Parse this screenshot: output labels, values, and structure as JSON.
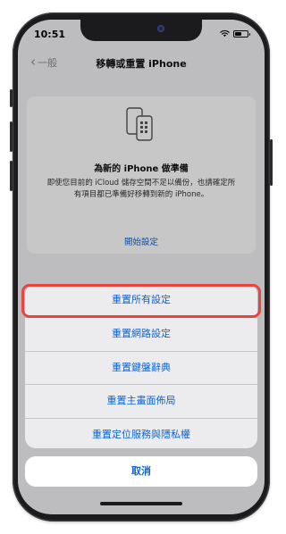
{
  "status_bar": {
    "time": "10:51"
  },
  "nav": {
    "back_label": "一般",
    "title": "移轉或重置 iPhone"
  },
  "card": {
    "icon": "phone-transfer-icon",
    "title": "為新的 iPhone 做準備",
    "body": "即使您目前的 iCloud 儲存空間不足以備份，也請確定所有項目都已準備好移轉到新的 iPhone。",
    "link": "開始設定"
  },
  "sheet": {
    "items": [
      {
        "label": "重置所有設定"
      },
      {
        "label": "重置網路設定"
      },
      {
        "label": "重置鍵盤辭典"
      },
      {
        "label": "重置主畫面佈局"
      },
      {
        "label": "重置定位服務與隱私權"
      }
    ],
    "cancel_label": "取消"
  },
  "colors": {
    "accent": "#0a64d6",
    "highlight": "#e9443f"
  }
}
